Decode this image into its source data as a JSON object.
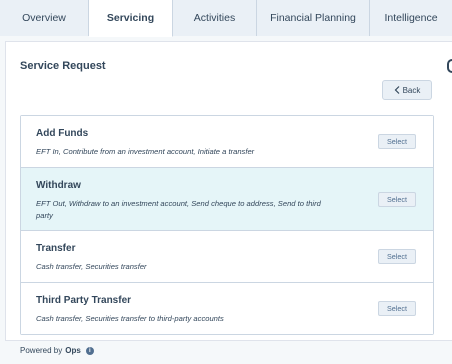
{
  "tabs": [
    {
      "label": "Overview",
      "active": false
    },
    {
      "label": "Servicing",
      "active": true
    },
    {
      "label": "Activities",
      "active": false
    },
    {
      "label": "Financial Planning",
      "active": false
    },
    {
      "label": "Intelligence",
      "active": false
    }
  ],
  "panel": {
    "title": "Service Request",
    "back_label": "Back"
  },
  "requests": [
    {
      "title": "Add Funds",
      "description": "EFT In, Contribute from an investment account, Initiate a transfer",
      "select_label": "Select",
      "highlighted": false
    },
    {
      "title": "Withdraw",
      "description": "EFT Out, Withdraw to an investment account, Send cheque to address, Send to third party",
      "select_label": "Select",
      "highlighted": true
    },
    {
      "title": "Transfer",
      "description": "Cash transfer, Securities transfer",
      "select_label": "Select",
      "highlighted": false
    },
    {
      "title": "Third Party Transfer",
      "description": "Cash transfer, Securities transfer to third-party accounts",
      "select_label": "Select",
      "highlighted": false
    }
  ],
  "footer": {
    "prefix": "Powered by",
    "brand": "Ops"
  },
  "colors": {
    "highlight_row": "#e5f5f8",
    "text": "#33475b",
    "border": "#cbd6e2"
  }
}
